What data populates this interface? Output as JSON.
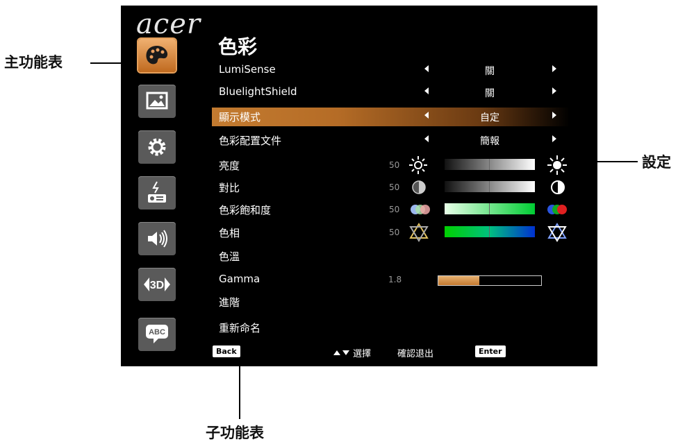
{
  "callouts": {
    "main_menu": "主功能表",
    "settings": "設定",
    "sub_menu": "子功能表"
  },
  "brand": "acer",
  "menu_title": "色彩",
  "tabs": [
    {
      "icon": "palette-icon",
      "active": true
    },
    {
      "icon": "picture-icon",
      "active": false
    },
    {
      "icon": "gear-icon",
      "active": false
    },
    {
      "icon": "projector-power-icon",
      "active": false
    },
    {
      "icon": "speaker-icon",
      "active": false
    },
    {
      "icon": "3d-icon",
      "active": false
    },
    {
      "icon": "abc-language-icon",
      "active": false
    }
  ],
  "rows": {
    "lumisense": {
      "label": "LumiSense",
      "value": "關"
    },
    "bluelight": {
      "label": "BluelightShield",
      "value": "關"
    },
    "display_mode": {
      "label": "顯示模式",
      "value": "自定"
    },
    "color_profile": {
      "label": "色彩配置文件",
      "value": "簡報"
    },
    "brightness": {
      "label": "亮度",
      "value": "50"
    },
    "contrast": {
      "label": "對比",
      "value": "50"
    },
    "saturation": {
      "label": "色彩飽和度",
      "value": "50"
    },
    "hue": {
      "label": "色相",
      "value": "50"
    },
    "color_temp": {
      "label": "色溫"
    },
    "gamma": {
      "label": "Gamma",
      "value": "1.8",
      "fill_fraction": 0.4
    },
    "advanced": {
      "label": "進階"
    },
    "rename": {
      "label": "重新命名"
    }
  },
  "footer": {
    "back": "Back",
    "select": "選擇",
    "confirm_exit": "確認退出",
    "enter": "Enter"
  },
  "colors": {
    "accent": "#c37b30",
    "tab_bg": "#5a5a5a",
    "osd_bg": "#000000"
  }
}
